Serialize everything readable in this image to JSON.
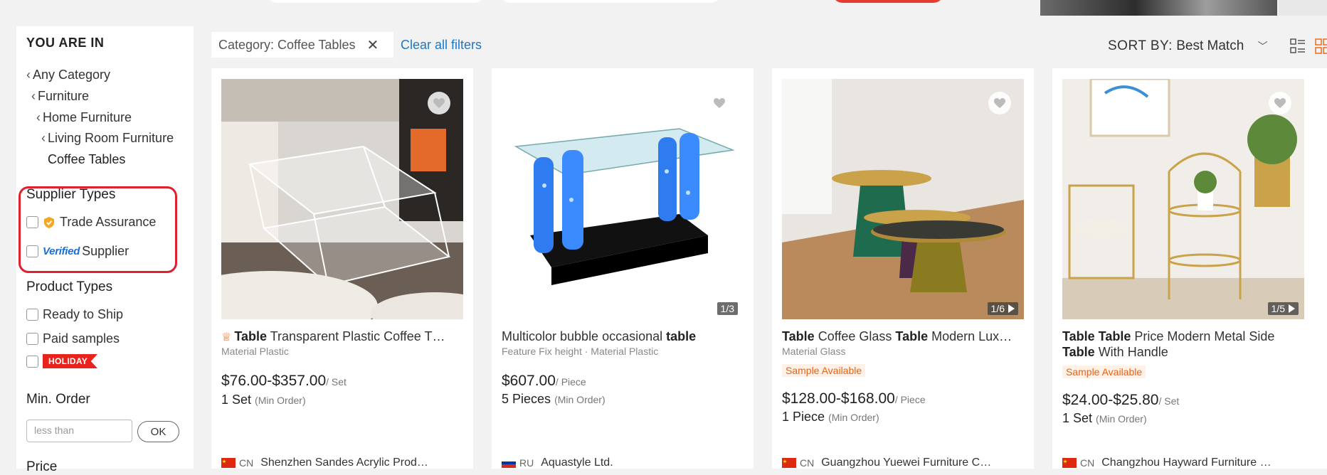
{
  "sidebar": {
    "title": "YOU ARE IN",
    "breadcrumbs": [
      "Any Category",
      "Furniture",
      "Home Furniture",
      "Living Room Furniture"
    ],
    "current_category": "Coffee Tables",
    "supplier_types": {
      "title": "Supplier Types",
      "trade_assurance": "Trade Assurance",
      "verified_badge": "Verified",
      "verified_label": "Supplier"
    },
    "product_types": {
      "title": "Product Types",
      "ready_to_ship": "Ready to Ship",
      "paid_samples": "Paid samples",
      "holiday_badge": "HOLIDAY"
    },
    "min_order": {
      "title": "Min. Order",
      "placeholder": "less than",
      "ok": "OK"
    },
    "price_title": "Price"
  },
  "filters": {
    "chip": "Category: Coffee Tables",
    "clear": "Clear all filters"
  },
  "sort": {
    "label": "SORT BY:",
    "value": "Best Match"
  },
  "products": [
    {
      "title_prefix": "Table",
      "title_rest": " Transparent Plastic Coffee T…",
      "attrs": "Material Plastic",
      "price": "$76.00-$357.00",
      "unit": "/ Set",
      "moq": "1 Set",
      "moq_note": "(Min Order)",
      "country": "CN",
      "supplier": "Shenzhen Sandes Acrylic Prod…"
    },
    {
      "title_plain": "Multicolor bubble occasional ",
      "title_bold": "table",
      "attrs": "Feature Fix height · Material Plastic",
      "image_count": "1/3",
      "price": "$607.00",
      "unit": "/ Piece",
      "moq": "5 Pieces",
      "moq_note": "(Min Order)",
      "country": "RU",
      "supplier": "Aquastyle Ltd."
    },
    {
      "t1": "Table",
      "t2": " Coffee Glass ",
      "t3": "Table",
      "t4": " Modern Lux…",
      "attrs": "Material Glass",
      "sample": "Sample Available",
      "image_count": "1/6",
      "price": "$128.00-$168.00",
      "unit": "/ Piece",
      "moq": "1 Piece",
      "moq_note": "(Min Order)",
      "country": "CN",
      "supplier": "Guangzhou Yuewei Furniture C…"
    },
    {
      "t1": "Table Table",
      "t2": " Price Modern Metal Side ",
      "t3": "Table",
      "t4": " With Handle",
      "sample": "Sample Available",
      "image_count": "1/5",
      "price": "$24.00-$25.80",
      "unit": "/ Set",
      "moq": "1 Set",
      "moq_note": "(Min Order)",
      "country": "CN",
      "supplier": "Changzhou Hayward Furniture …"
    }
  ]
}
